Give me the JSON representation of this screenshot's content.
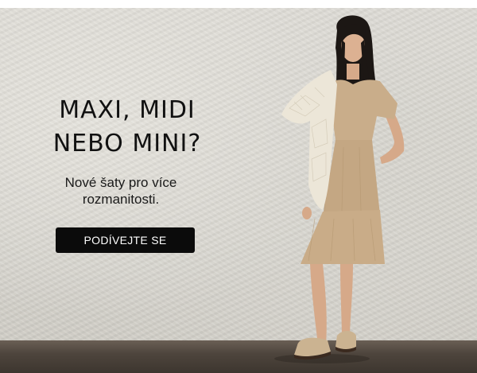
{
  "banner": {
    "headline": "MAXI, MIDI NEBO MINI?",
    "subtext": "Nové šaty pro více rozmanitosti.",
    "cta_label": "PODÍVEJTE SE"
  },
  "colors": {
    "wall": "#d9d7d1",
    "floor": "#4e453d",
    "button": "#0b0b0b",
    "button_text": "#ffffff",
    "dress": "#c9ad8a"
  }
}
